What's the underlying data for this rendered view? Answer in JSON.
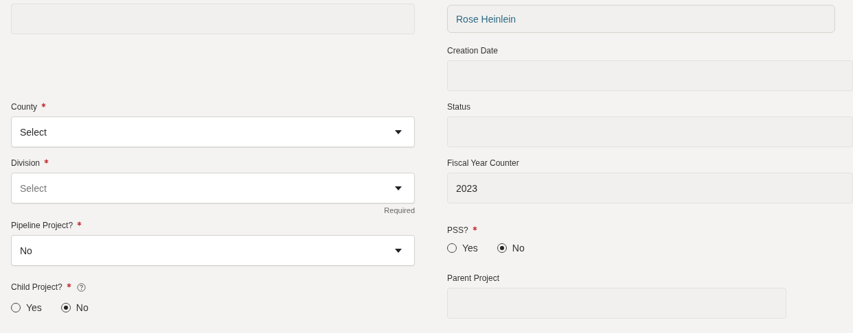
{
  "left_column": [
    {
      "kind": "readonly"
    },
    {
      "kind": "select",
      "label": "County",
      "required": true,
      "value": "Select"
    },
    {
      "kind": "select",
      "label": "Division",
      "required": true,
      "placeholder": "Select",
      "helper": "Required"
    },
    {
      "kind": "select",
      "label": "Pipeline Project?",
      "required": true,
      "value": "No"
    },
    {
      "kind": "radio",
      "label": "Child Project?",
      "required": true,
      "help": true,
      "options": [
        {
          "label": "Yes",
          "selected": false
        },
        {
          "label": "No",
          "selected": true
        }
      ]
    }
  ],
  "right_column": [
    {
      "kind": "readonly",
      "value": "Rose Heinlein",
      "link": true
    },
    {
      "kind": "readonly",
      "label": "Creation Date"
    },
    {
      "kind": "readonly",
      "label": "Status"
    },
    {
      "kind": "readonly",
      "label": "Fiscal Year Counter",
      "value": "2023"
    },
    {
      "kind": "radio",
      "label": "PSS?",
      "required": true,
      "options": [
        {
          "label": "Yes",
          "selected": false
        },
        {
          "label": "No",
          "selected": true
        }
      ]
    },
    {
      "kind": "readonly",
      "label": "Parent Project"
    }
  ]
}
